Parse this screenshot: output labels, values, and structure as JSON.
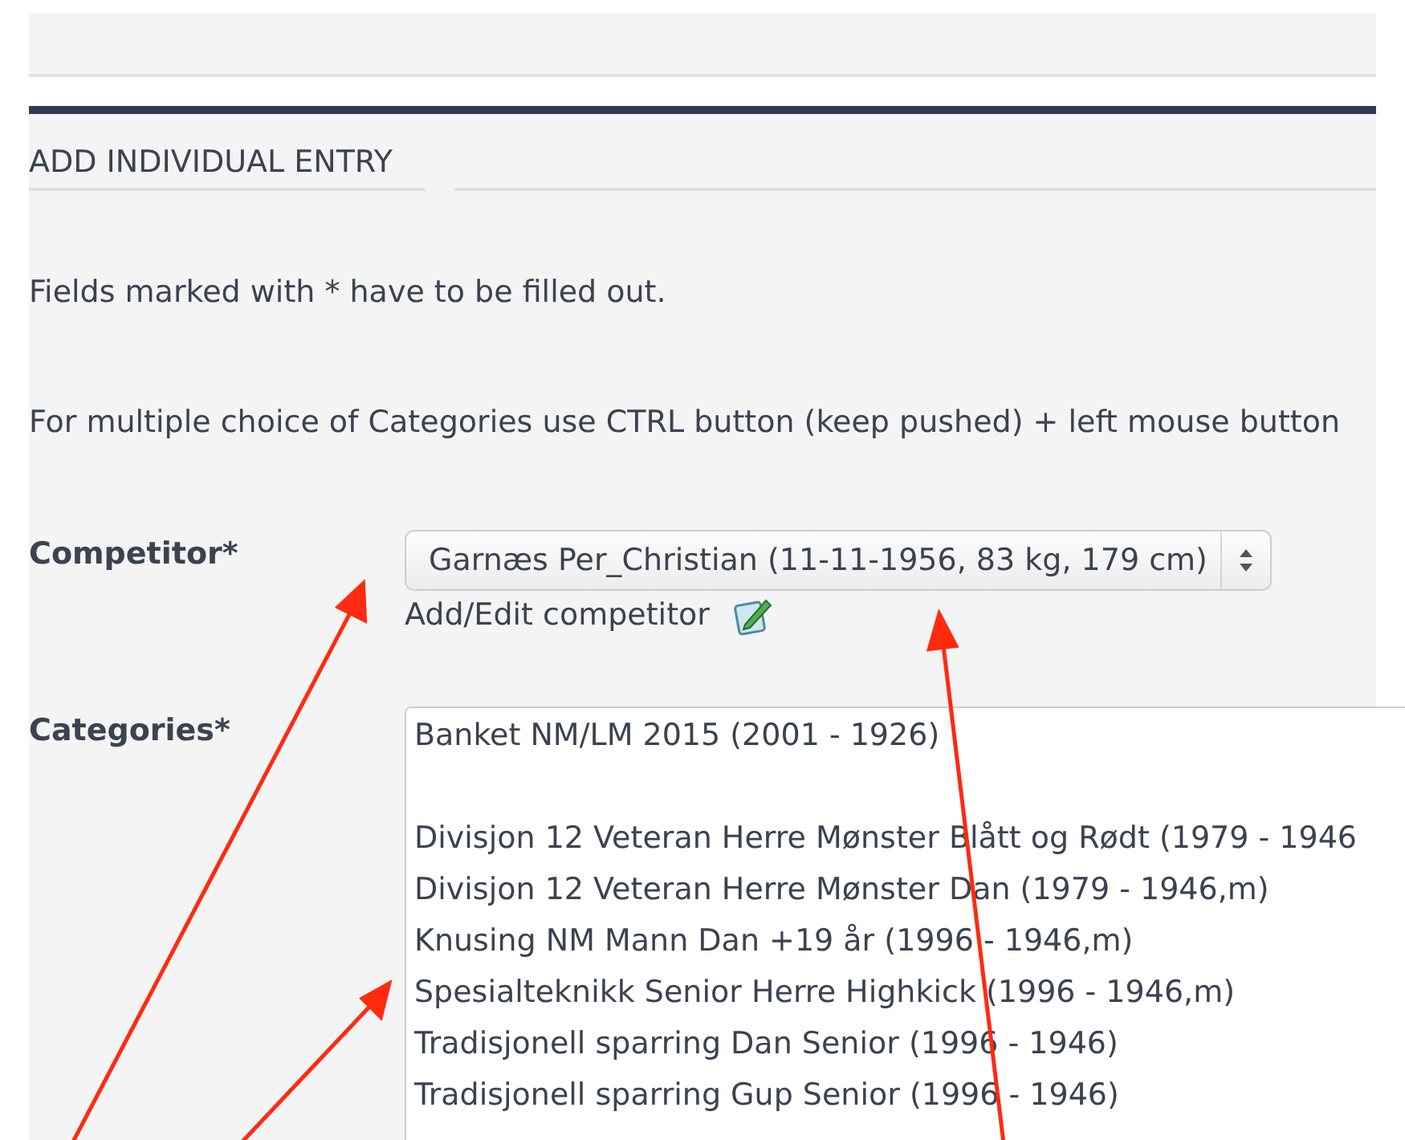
{
  "section_title": "ADD INDIVIDUAL ENTRY",
  "notes": [
    "Fields marked with * have to be filled out.",
    "For multiple choice of Categories use CTRL button (keep pushed) + left mouse button"
  ],
  "competitor": {
    "label": "Competitor*",
    "value": "Garnæs Per_Christian (11-11-1956, 83 kg, 179 cm)",
    "link": "Add/Edit competitor"
  },
  "categories": {
    "label": "Categories*",
    "options": [
      {
        "kind": "option",
        "text": "Banket NM/LM 2015 (2001 - 1926)"
      },
      {
        "kind": "blank"
      },
      {
        "kind": "option",
        "text": "Divisjon 12 Veteran Herre Mønster Blått og Rødt (1979 - 1946"
      },
      {
        "kind": "option",
        "text": "Divisjon 12 Veteran Herre Mønster Dan (1979 - 1946,m)"
      },
      {
        "kind": "option",
        "text": "Knusing NM Mann Dan +19 år (1996 - 1946,m)"
      },
      {
        "kind": "option",
        "text": "Spesialteknikk Senior Herre Highkick (1996 - 1946,m)"
      },
      {
        "kind": "option",
        "text": "Tradisjonell sparring Dan Senior (1996 - 1946)"
      },
      {
        "kind": "option",
        "text": "Tradisjonell sparring Gup Senior (1996 - 1946)"
      }
    ]
  }
}
